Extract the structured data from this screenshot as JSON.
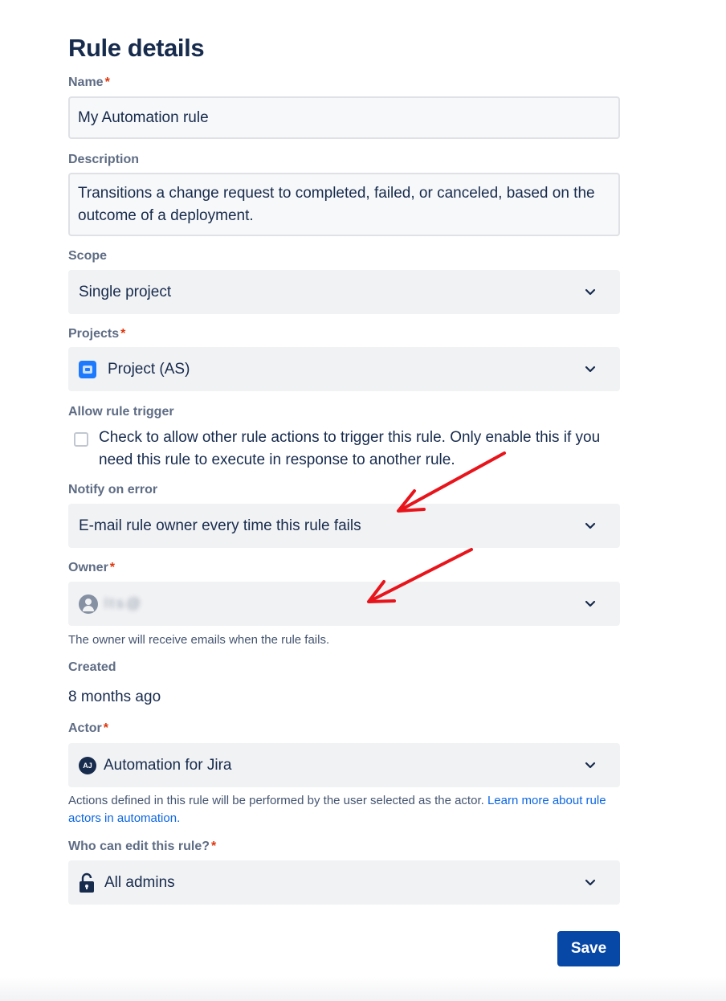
{
  "title": "Rule details",
  "required_marker": "*",
  "name": {
    "label": "Name",
    "value": "My Automation rule"
  },
  "description": {
    "label": "Description",
    "value": "Transitions a change request to completed, failed, or canceled, based on the outcome of a deployment."
  },
  "scope": {
    "label": "Scope",
    "value": "Single project"
  },
  "projects": {
    "label": "Projects",
    "value": "Project (AS)"
  },
  "allow_trigger": {
    "label": "Allow rule trigger",
    "checkbox_text": "Check to allow other rule actions to trigger this rule. Only enable this if you need this rule to execute in response to another rule.",
    "checked": false
  },
  "notify": {
    "label": "Notify on error",
    "value": "E-mail rule owner every time this rule fails"
  },
  "owner": {
    "label": "Owner",
    "value": "lts@",
    "helper": "The owner will receive emails when the rule fails."
  },
  "created": {
    "label": "Created",
    "value": "8 months ago"
  },
  "actor": {
    "label": "Actor",
    "avatar_initials": "AJ",
    "value": "Automation for Jira",
    "helper": "Actions defined in this rule will be performed by the user selected as the actor.",
    "link_text": "Learn more about rule actors in automation."
  },
  "edit": {
    "label": "Who can edit this rule?",
    "value": "All admins"
  },
  "save_label": "Save",
  "icons": {
    "chevron": "chevron-down-icon",
    "project": "project-icon",
    "owner": "user-avatar-icon",
    "lock": "unlock-icon"
  },
  "colors": {
    "primary": "#0747a6",
    "required": "#de350b",
    "annotation_arrow": "#e8141b",
    "field_bg": "#f1f2f4"
  }
}
